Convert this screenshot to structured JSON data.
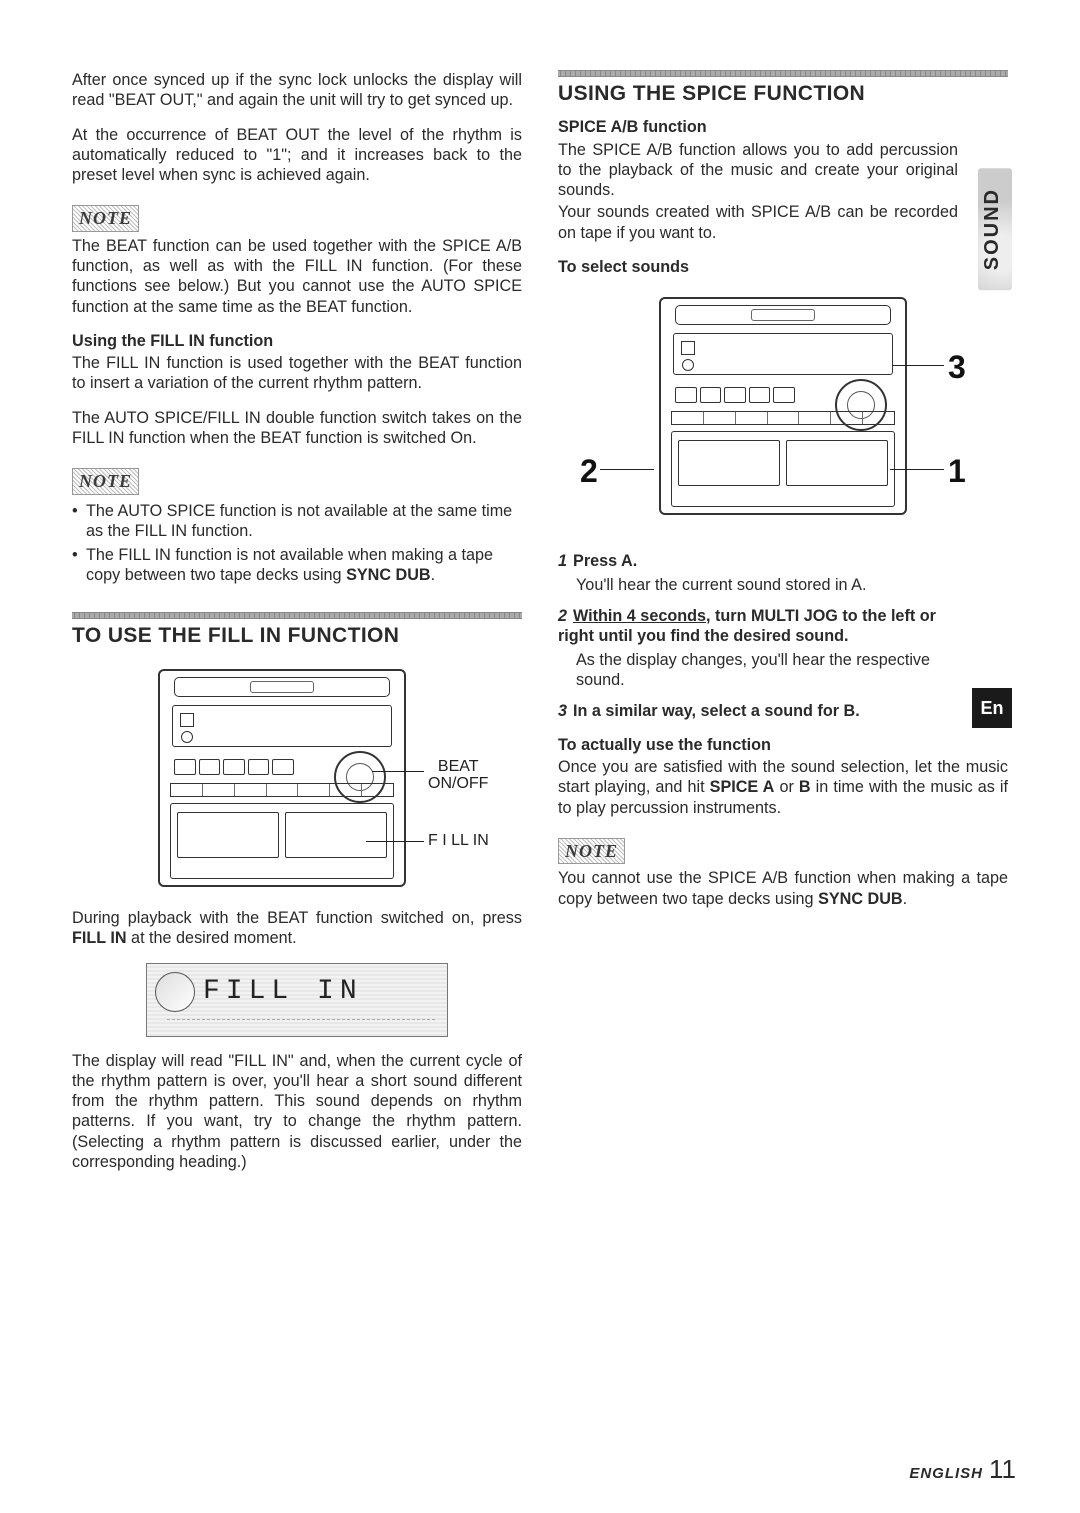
{
  "left": {
    "intro1": "After once synced up if the sync lock unlocks the display will read \"BEAT OUT,\" and again the unit will try to get synced up.",
    "intro2": "At the occurrence of BEAT OUT the level of the rhythm is automatically reduced to \"1\"; and it increases back to the preset level when sync is achieved again.",
    "noteLabel": "NOTE",
    "note1": "The BEAT function can be used together with the SPICE A/B function, as well as with the FILL IN function. (For these functions see below.) But you cannot use the AUTO SPICE function at the same time as the BEAT function.",
    "fillHead": "Using the FILL IN function",
    "fill1": "The FILL IN function is used together with the BEAT function to insert a variation of the current rhythm pattern.",
    "fill2": "The AUTO SPICE/FILL IN double function switch takes on the FILL IN function when the BEAT function is switched On.",
    "note2b1": "The AUTO SPICE function is not available at the same time as the FILL IN function.",
    "note2b2_pre": "The FILL IN function is not available when making a tape copy between two tape decks using ",
    "note2b2_bold": "SYNC DUB",
    "note2b2_post": ".",
    "secTitle": "TO USE THE FILL IN FUNCTION",
    "cl_beat": "BEAT\nON/OFF",
    "cl_fill": "F I LL IN",
    "during_pre": "During playback with the BEAT function switched on, press ",
    "during_bold": "FILL IN",
    "during_post": " at the desired moment.",
    "lcdText": "FILL   IN",
    "closing": "The display will read \"FILL IN\" and, when the current cycle of the rhythm pattern is over, you'll hear a short sound different from the rhythm pattern. This sound depends on rhythm patterns. If you want, try to change the rhythm pattern. (Selecting a rhythm pattern is discussed earlier, under the corresponding heading.)"
  },
  "right": {
    "secTitle": "USING THE SPICE FUNCTION",
    "spiceHead": "SPICE A/B function",
    "spice1": "The SPICE A/B function allows you to add percussion to the playback of the music and create your original sounds.",
    "spice2": "Your sounds created with SPICE A/B can be recorded on tape if you want to.",
    "selectHead": "To select sounds",
    "num1": "1",
    "num2": "2",
    "num3": "3",
    "s1n": "1",
    "s1t": "Press A.",
    "s1b": "You'll hear the current sound stored in A.",
    "s2n": "2",
    "s2t_u": "Within 4 seconds",
    "s2t_rest": ", turn MULTI JOG to the left or right until you find the desired sound.",
    "s2b": "As the display changes, you'll hear the respective sound.",
    "s3n": "3",
    "s3t": "In a similar way, select a sound for B.",
    "useHead": "To actually use the function",
    "use_pre": "Once you are satisfied with the sound selection, let the music start playing, and hit ",
    "use_bold": "SPICE A",
    "use_mid": " or ",
    "use_bold2": "B",
    "use_post": " in time with the music as if to play percussion instruments.",
    "noteLabel": "NOTE",
    "note_pre": "You cannot use the SPICE A/B function when making a tape copy between two tape decks using ",
    "note_bold": "SYNC DUB",
    "note_post": ".",
    "sideSound": "SOUND",
    "enTab": "En"
  },
  "footer": {
    "lang": "ENGLISH",
    "page": "11"
  }
}
